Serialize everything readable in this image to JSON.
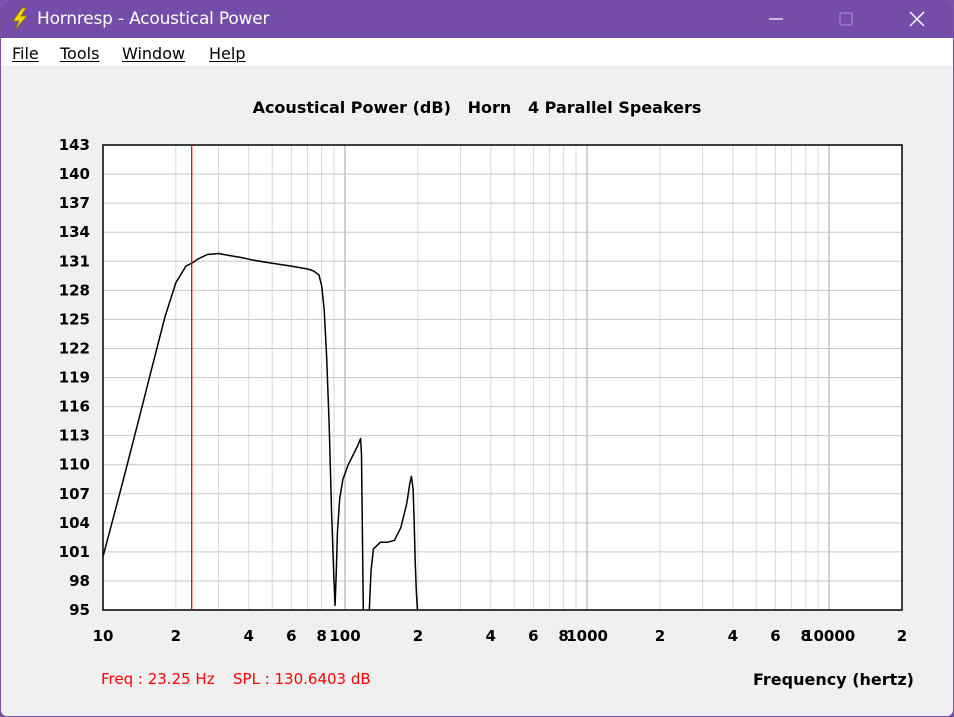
{
  "window": {
    "title": "Hornresp - Acoustical Power",
    "icon": "lightning-bolt-icon",
    "controls": [
      "minimize-icon",
      "maximize-icon",
      "close-icon"
    ],
    "titlebar_color": "#744da9"
  },
  "menu": {
    "items": [
      {
        "label": "File"
      },
      {
        "label": "Tools"
      },
      {
        "label": "Window"
      },
      {
        "label": "Help"
      }
    ]
  },
  "readout": {
    "freq": "Freq : 23.25 Hz",
    "spl": "SPL : 130.6403 dB",
    "color": "#ff0000"
  },
  "chart_data": {
    "type": "line",
    "title": "Acoustical Power (dB)   Horn   4 Parallel Speakers",
    "xlabel": "Frequency (hertz)",
    "ylabel": "",
    "x_scale": "log",
    "xlim": [
      10,
      20000
    ],
    "ylim": [
      95,
      143
    ],
    "grid": true,
    "ytick_labels": [
      "143",
      "140",
      "137",
      "134",
      "131",
      "128",
      "125",
      "122",
      "119",
      "116",
      "113",
      "110",
      "107",
      "104",
      "101",
      "98",
      "95"
    ],
    "xtick_labels": [
      {
        "value": 10,
        "label": "10"
      },
      {
        "value": 20,
        "label": "2"
      },
      {
        "value": 40,
        "label": "4"
      },
      {
        "value": 60,
        "label": "6"
      },
      {
        "value": 80,
        "label": "8"
      },
      {
        "value": 100,
        "label": "100"
      },
      {
        "value": 200,
        "label": "2"
      },
      {
        "value": 400,
        "label": "4"
      },
      {
        "value": 600,
        "label": "6"
      },
      {
        "value": 800,
        "label": "8"
      },
      {
        "value": 1000,
        "label": "1000"
      },
      {
        "value": 2000,
        "label": "2"
      },
      {
        "value": 4000,
        "label": "4"
      },
      {
        "value": 6000,
        "label": "6"
      },
      {
        "value": 8000,
        "label": "8"
      },
      {
        "value": 10000,
        "label": "10000"
      },
      {
        "value": 20000,
        "label": "2"
      }
    ],
    "cursor": {
      "x": 23.25,
      "y": 130.6403,
      "color": "#ff0000"
    },
    "series": [
      {
        "color": "#000000",
        "points": [
          [
            10,
            100.5
          ],
          [
            12,
            108
          ],
          [
            14,
            114.5
          ],
          [
            16,
            120.2
          ],
          [
            18,
            125.2
          ],
          [
            20,
            128.8
          ],
          [
            22,
            130.5
          ],
          [
            23.25,
            130.8
          ],
          [
            25,
            131.3
          ],
          [
            27,
            131.7
          ],
          [
            30,
            131.8
          ],
          [
            33,
            131.6
          ],
          [
            37,
            131.4
          ],
          [
            42,
            131.1
          ],
          [
            50,
            130.8
          ],
          [
            60,
            130.5
          ],
          [
            70,
            130.2
          ],
          [
            74,
            130.0
          ],
          [
            78,
            129.6
          ],
          [
            80,
            128.5
          ],
          [
            82,
            126
          ],
          [
            84,
            121
          ],
          [
            86,
            114
          ],
          [
            88,
            105
          ],
          [
            90,
            98
          ],
          [
            91,
            95.5
          ],
          [
            92,
            99
          ],
          [
            93,
            103
          ],
          [
            95,
            106.5
          ],
          [
            98,
            108.5
          ],
          [
            103,
            110
          ],
          [
            108,
            111
          ],
          [
            113,
            112
          ],
          [
            116,
            112.7
          ],
          [
            117,
            111
          ],
          [
            118,
            103
          ],
          [
            119,
            95
          ]
        ]
      },
      {
        "color": "#000000",
        "points": [
          [
            126,
            95
          ],
          [
            128,
            99
          ],
          [
            131,
            101.3
          ],
          [
            140,
            102
          ],
          [
            150,
            102
          ],
          [
            160,
            102.2
          ],
          [
            170,
            103.5
          ],
          [
            180,
            106
          ],
          [
            185,
            108
          ],
          [
            188,
            108.8
          ],
          [
            191,
            107.5
          ],
          [
            193,
            104
          ],
          [
            195,
            100
          ],
          [
            197,
            97
          ],
          [
            199,
            95
          ]
        ]
      }
    ]
  }
}
